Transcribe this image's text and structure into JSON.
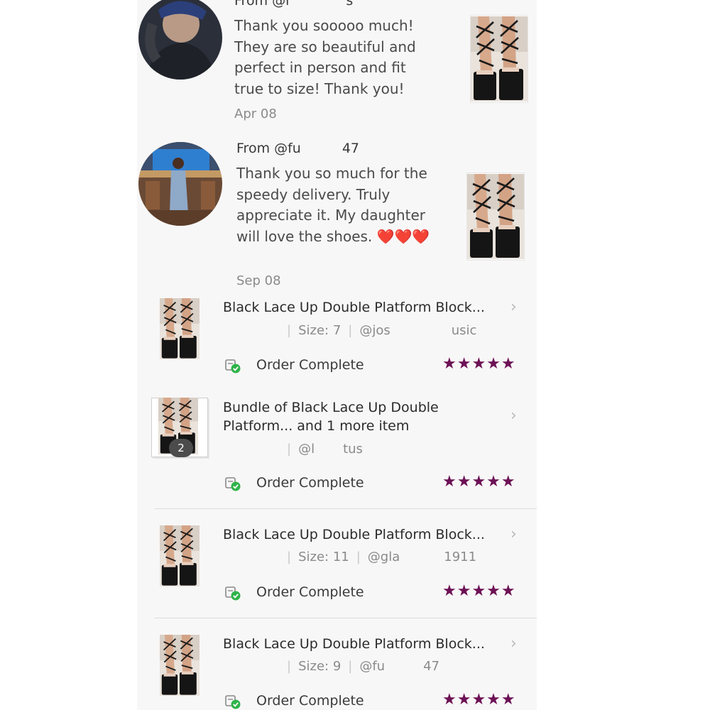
{
  "reviews": [
    {
      "from": "From @l",
      "from_suffix": "s",
      "text": "Thank you sooooo much! They are so beautiful and perfect in person and fit true to size! Thank you!",
      "date": "Apr 08"
    },
    {
      "from": "From @fu",
      "from_suffix": "47",
      "text": "Thank you so much for the speedy delivery. Truly appreciate it. My daughter will love the shoes. ❤️❤️❤️",
      "date": "Sep 08"
    }
  ],
  "orders": [
    {
      "title": "Black Lace Up Double Platform Block...",
      "size": "Size: 7",
      "user_prefix": "@jos",
      "user_suffix": "usic",
      "status": "Order Complete",
      "rating": 5,
      "stars": "★★★★★"
    },
    {
      "title_line1": "Bundle of Black Lace Up Double",
      "title_line2": "Platform... and 1 more item",
      "user_prefix": "@l",
      "user_suffix": "tus",
      "badge": "2",
      "status": "Order Complete",
      "rating": 5,
      "stars": "★★★★★"
    },
    {
      "title": "Black Lace Up Double Platform Block...",
      "size": "Size: 11",
      "user_prefix": "@gla",
      "user_suffix": "1911",
      "status": "Order Complete",
      "rating": 5,
      "stars": "★★★★★"
    },
    {
      "title": "Black Lace Up Double Platform Block...",
      "size": "Size: 9",
      "user_prefix": "@fu",
      "user_suffix": "47",
      "status": "Order Complete",
      "rating": 5,
      "stars": "★★★★★"
    }
  ],
  "icons": {
    "chevron": "chevron-right-icon",
    "status": "order-complete-icon",
    "star": "star-icon"
  },
  "colors": {
    "star": "#6c1155",
    "status_check": "#2fb34a",
    "background": "#f8f7f7"
  }
}
